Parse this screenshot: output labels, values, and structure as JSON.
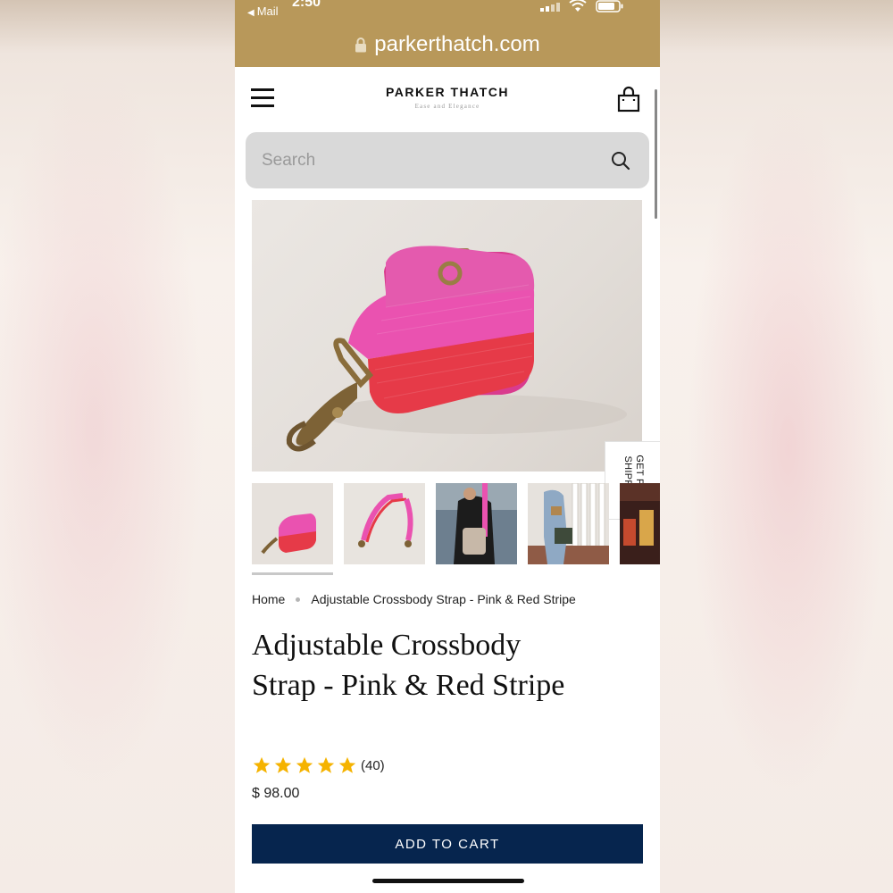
{
  "status_bar": {
    "back_label": "Mail",
    "time_fragment": "2:50"
  },
  "browser": {
    "url": "parkerthatch.com"
  },
  "header": {
    "brand_name": "PARKER THATCH",
    "brand_tagline": "Ease and Elegance"
  },
  "search": {
    "placeholder": "Search"
  },
  "side_tab": {
    "label": "GET FREE SHIPPING"
  },
  "breadcrumb": {
    "home": "Home",
    "current": "Adjustable Crossbody Strap - Pink & Red Stripe"
  },
  "product": {
    "title": "Adjustable Crossbody Strap - Pink & Red Stripe",
    "rating_stars": 5,
    "rating_count": "(40)",
    "price": "$ 98.00",
    "add_to_cart_label": "ADD TO CART"
  },
  "colors": {
    "status_bar": "#b8985a",
    "cta": "#06254e",
    "star": "#f5b301",
    "strap_pink": "#e84aa8",
    "strap_red": "#e8384a"
  }
}
